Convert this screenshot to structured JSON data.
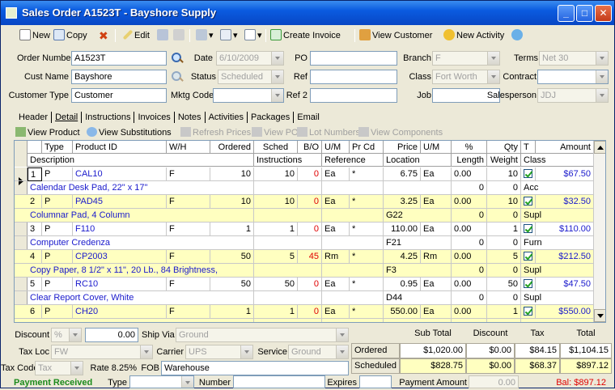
{
  "window": {
    "title": "Sales Order A1523T - Bayshore Supply",
    "controls": {
      "minimize": "_",
      "maximize": "□",
      "close": "✕"
    }
  },
  "toolbar": {
    "new": "New",
    "copy": "Copy",
    "edit": "Edit",
    "create_invoice": "Create Invoice",
    "view_customer": "View Customer",
    "new_activity": "New Activity"
  },
  "form": {
    "order_number_label": "Order Number",
    "order_number": "A1523T",
    "date_label": "Date",
    "date": "6/10/2009",
    "po_label": "PO",
    "po": "",
    "branch_label": "Branch",
    "branch": "F",
    "terms_label": "Terms",
    "terms": "Net 30",
    "cust_name_label": "Cust Name",
    "cust_name": "Bayshore",
    "status_label": "Status",
    "status": "Scheduled",
    "ref_label": "Ref",
    "ref": "",
    "class_label": "Class",
    "class": "Fort Worth",
    "contract_label": "Contract",
    "contract": "",
    "customer_type_label": "Customer Type",
    "customer_type": "Customer",
    "mktg_code_label": "Mktg Code",
    "mktg_code": "",
    "ref2_label": "Ref 2",
    "ref2": "",
    "job_label": "Job",
    "job": "",
    "salesperson_label": "Salesperson",
    "salesperson": "JDJ"
  },
  "tabs": [
    "Header",
    "Detail",
    "Instructions",
    "Invoices",
    "Notes",
    "Activities",
    "Packages",
    "Email"
  ],
  "active_tab": "Detail",
  "detail_toolbar": {
    "view_product": "View Product",
    "view_substitutions": "View Substitutions",
    "refresh_prices": "Refresh Prices",
    "view_po": "View PO",
    "lot_numbers": "Lot Numbers",
    "view_components": "View Components"
  },
  "grid": {
    "header1": [
      "Type",
      "Product ID",
      "W/H",
      "Ordered",
      "Sched",
      "B/O",
      "U/M",
      "Pr Cd",
      "Price",
      "U/M",
      "%",
      "Qty",
      "T",
      "Amount"
    ],
    "header2": [
      "Description",
      "Instructions",
      "Reference",
      "Location",
      "Length",
      "Weight",
      "Class"
    ],
    "rows": [
      {
        "line": "1",
        "type": "P",
        "product": "CAL10",
        "wh": "F",
        "ordered": "10",
        "sched": "10",
        "bo": "0",
        "um": "Ea",
        "prcd": "*",
        "price": "6.75",
        "pum": "Ea",
        "pct": "0.00",
        "qty": "10",
        "amount": "$67.50",
        "desc": "Calendar Desk Pad, 22\" x 17\"",
        "location": "",
        "length": "0",
        "weight": "0",
        "class": "Acc"
      },
      {
        "line": "2",
        "type": "P",
        "product": "PAD45",
        "wh": "F",
        "ordered": "10",
        "sched": "10",
        "bo": "0",
        "um": "Ea",
        "prcd": "*",
        "price": "3.25",
        "pum": "Ea",
        "pct": "0.00",
        "qty": "10",
        "amount": "$32.50",
        "desc": "Columnar Pad, 4 Column",
        "location": "G22",
        "length": "0",
        "weight": "0",
        "class": "Supl"
      },
      {
        "line": "3",
        "type": "P",
        "product": "F110",
        "wh": "F",
        "ordered": "1",
        "sched": "1",
        "bo": "0",
        "um": "Ea",
        "prcd": "*",
        "price": "110.00",
        "pum": "Ea",
        "pct": "0.00",
        "qty": "1",
        "amount": "$110.00",
        "desc": "Computer Credenza",
        "location": "F21",
        "length": "0",
        "weight": "0",
        "class": "Furn"
      },
      {
        "line": "4",
        "type": "P",
        "product": "CP2003",
        "wh": "F",
        "ordered": "50",
        "sched": "5",
        "bo": "45",
        "um": "Rm",
        "prcd": "*",
        "price": "4.25",
        "pum": "Rm",
        "pct": "0.00",
        "qty": "5",
        "amount": "$212.50",
        "desc": "Copy Paper, 8 1/2\" x 11\", 20 Lb., 84 Brightness,",
        "location": "F3",
        "length": "0",
        "weight": "0",
        "class": "Supl"
      },
      {
        "line": "5",
        "type": "P",
        "product": "RC10",
        "wh": "F",
        "ordered": "50",
        "sched": "50",
        "bo": "0",
        "um": "Ea",
        "prcd": "*",
        "price": "0.95",
        "pum": "Ea",
        "pct": "0.00",
        "qty": "50",
        "amount": "$47.50",
        "desc": "Clear Report Cover, White",
        "location": "D44",
        "length": "0",
        "weight": "0",
        "class": "Supl"
      },
      {
        "line": "6",
        "type": "P",
        "product": "CH20",
        "wh": "F",
        "ordered": "1",
        "sched": "1",
        "bo": "0",
        "um": "Ea",
        "prcd": "*",
        "price": "550.00",
        "pum": "Ea",
        "pct": "0.00",
        "qty": "1",
        "amount": "$550.00",
        "desc": "",
        "location": "",
        "length": "",
        "weight": "",
        "class": ""
      }
    ]
  },
  "footer": {
    "discount_label": "Discount",
    "discount_type": "%",
    "discount_value": "0.00",
    "ship_via_label": "Ship Via",
    "ship_via": "Ground",
    "tax_loc_label": "Tax Loc",
    "tax_loc": "FW",
    "carrier_label": "Carrier",
    "carrier": "UPS",
    "service_label": "Service",
    "service": "Ground",
    "tax_code_label": "Tax Code",
    "tax_code": "Tax",
    "rate_label": "Rate 8.25%",
    "fob_label": "FOB",
    "fob": "Warehouse"
  },
  "totals": {
    "headers": [
      "Sub Total",
      "Discount",
      "Tax",
      "Total"
    ],
    "ordered_label": "Ordered",
    "ordered": [
      "$1,020.00",
      "$0.00",
      "$84.15",
      "$1,104.15"
    ],
    "scheduled_label": "Scheduled",
    "scheduled": [
      "$828.75",
      "$0.00",
      "$68.37",
      "$897.12"
    ]
  },
  "payment": {
    "label": "Payment Received",
    "type_label": "Type",
    "type": "",
    "number_label": "Number",
    "number": "",
    "expires_label": "Expires",
    "expires": "",
    "amount_label": "Payment Amount",
    "amount": "0.00",
    "balance": "Bal: $897.12"
  },
  "colors": {
    "title_blue": "#0a5be0",
    "row_yellow": "#ffffc0",
    "link_blue": "#1a1acc",
    "bo_red": "#e00000",
    "pay_green": "#1b8a1b",
    "balance_red": "#e00000"
  }
}
